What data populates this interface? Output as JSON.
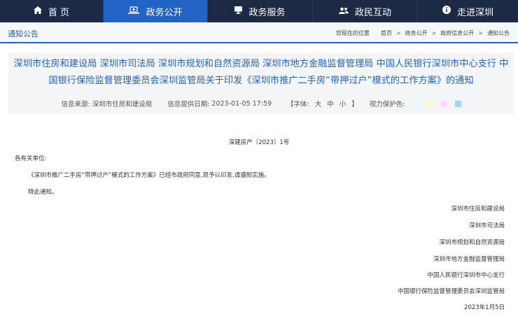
{
  "nav": {
    "items": [
      {
        "label": "首 页",
        "icon": "home-icon"
      },
      {
        "label": "政务公开",
        "icon": "government-icon"
      },
      {
        "label": "政务服务",
        "icon": "monitor-icon"
      },
      {
        "label": "政民互动",
        "icon": "people-icon"
      },
      {
        "label": "走进深圳",
        "icon": "info-icon"
      }
    ],
    "active_index": 1,
    "colors": {
      "bar": "#1d2a45",
      "active": "#2164c3"
    }
  },
  "breadcrumb": {
    "section_title": "通知公告",
    "lead": "您现在的位置",
    "items": [
      "首页",
      "政务公开",
      "政府信息公开",
      "通知公告"
    ],
    "separator": ">"
  },
  "article": {
    "title": "深圳市住房和建设局 深圳市司法局 深圳市规划和自然资源局 深圳市地方金融监督管理局 中国人民银行深圳市中心支行 中国银行保险监督管理委员会深圳监管局关于印发《深圳市推广二手房“带押过户”模式的工作方案》的通知",
    "source_label": "信息来源:",
    "source": "深圳市住房和建设局",
    "date_label": "信息提供日期:",
    "date": "2023-01-05 17:59",
    "font_open": "【字体:",
    "font_sizes": [
      "大",
      "中",
      "小"
    ],
    "font_close": "】",
    "vision_label": "视力保护色:",
    "vision_colors": [
      "#e3f5fb",
      "#f8f8cf",
      "#f7ddf6",
      "#a9d1f3"
    ]
  },
  "document": {
    "number": "深建房产〔2023〕1号",
    "salutation": "各有关单位:",
    "paragraphs": [
      "《深圳市推广二手房“带押过户”模式的工作方案》已经市政府同意,现予以印发,请遵照实施。",
      "特此通知。"
    ],
    "signatories": [
      "深圳市住房和建设局",
      "深圳市司法局",
      "深圳市规划和自然资源局",
      "深圳市地方金融监督管理局",
      "中国人民银行深圳市中心支行",
      "中国银行保险监督管理委员会深圳监管局",
      "2023年1月5日"
    ]
  }
}
